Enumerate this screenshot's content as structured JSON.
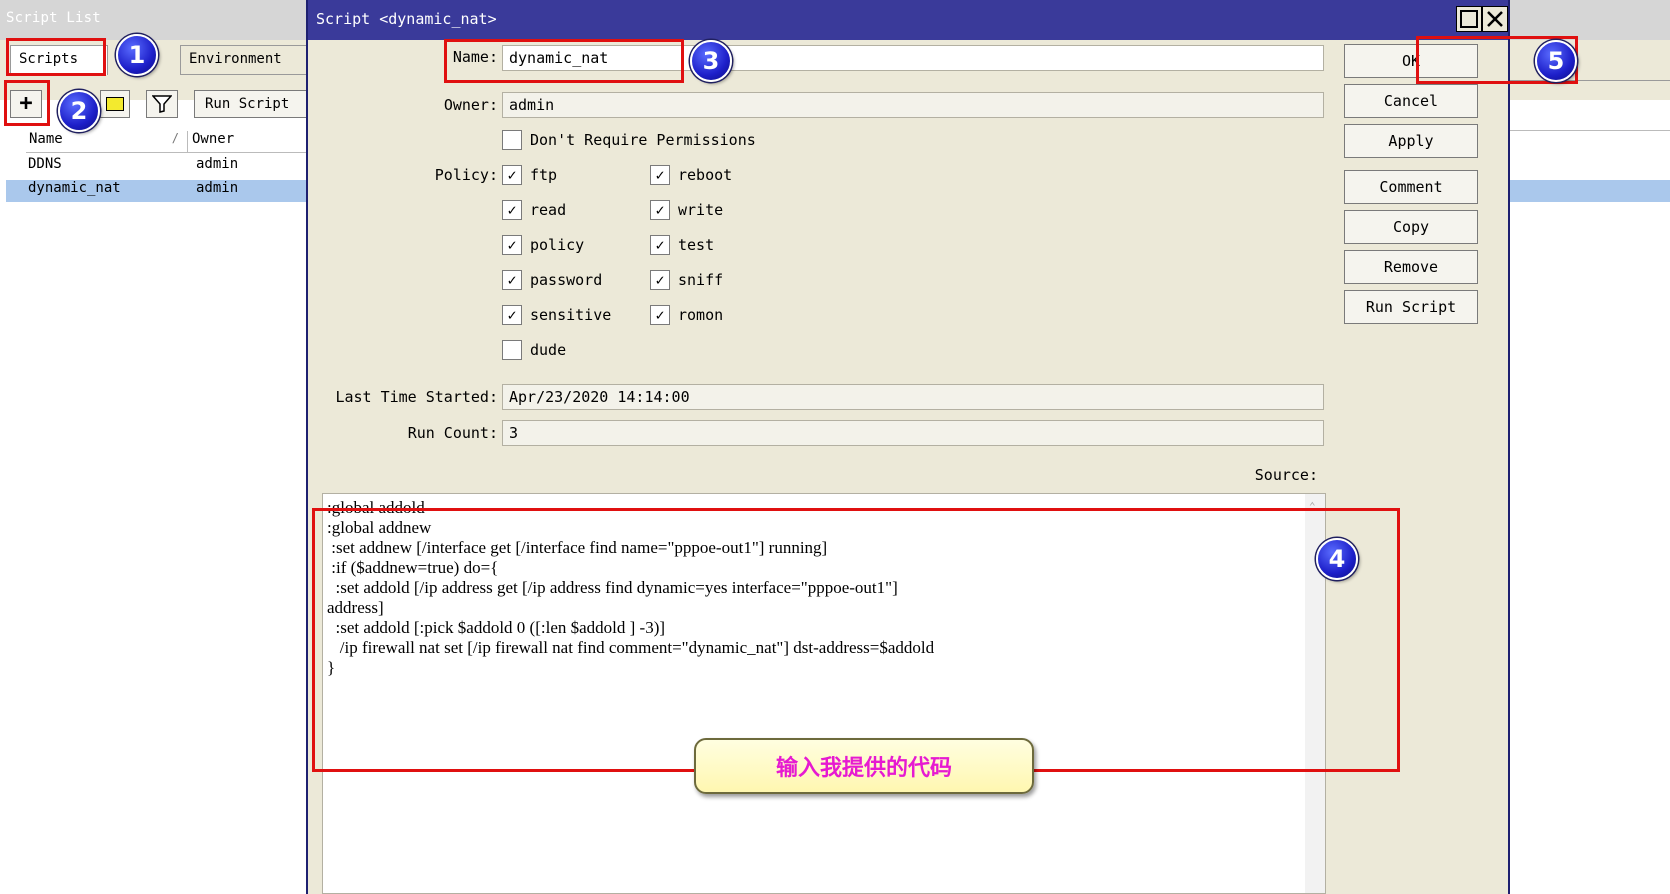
{
  "bg_window": {
    "title": "Script List",
    "tabs": [
      "Scripts",
      "Environment"
    ],
    "toolbar": {
      "add_label": "+",
      "run_label": "Run Script"
    },
    "columns": {
      "name": "Name",
      "owner": "Owner"
    },
    "rows": [
      {
        "name": "DDNS",
        "owner": "admin"
      },
      {
        "name": "dynamic_nat",
        "owner": "admin"
      }
    ]
  },
  "dialog": {
    "title": "Script <dynamic_nat>",
    "name_label": "Name:",
    "name_value": "dynamic_nat",
    "owner_label": "Owner:",
    "owner_value": "admin",
    "dont_require_label": "Don't Require Permissions",
    "policy_label": "Policy:",
    "policies": [
      {
        "label": "ftp",
        "checked": true
      },
      {
        "label": "reboot",
        "checked": true
      },
      {
        "label": "read",
        "checked": true
      },
      {
        "label": "write",
        "checked": true
      },
      {
        "label": "policy",
        "checked": true
      },
      {
        "label": "test",
        "checked": true
      },
      {
        "label": "password",
        "checked": true
      },
      {
        "label": "sniff",
        "checked": true
      },
      {
        "label": "sensitive",
        "checked": true
      },
      {
        "label": "romon",
        "checked": true
      },
      {
        "label": "dude",
        "checked": false
      }
    ],
    "last_started_label": "Last Time Started:",
    "last_started_value": "Apr/23/2020 14:14:00",
    "run_count_label": "Run Count:",
    "run_count_value": "3",
    "source_label": "Source:",
    "source_text": ":global addold\n:global addnew\n :set addnew [/interface get [/interface find name=\"pppoe-out1\"] running]\n :if ($addnew=true) do={\n  :set addold [/ip address get [/ip address find dynamic=yes interface=\"pppoe-out1\"]\naddress]\n  :set addold [:pick $addold 0 ([:len $addold ] -3)]\n   /ip firewall nat set [/ip firewall nat find comment=\"dynamic_nat\"] dst-address=$addold\n}",
    "buttons": {
      "ok": "OK",
      "cancel": "Cancel",
      "apply": "Apply",
      "comment": "Comment",
      "copy": "Copy",
      "remove": "Remove",
      "run_script": "Run Script"
    }
  },
  "annotations": {
    "badges": [
      "1",
      "2",
      "3",
      "4",
      "5"
    ],
    "callout_text": "输入我提供的代码"
  },
  "colors": {
    "highlight_red": "#e01010",
    "badge_blue": "#1d1fc9",
    "callout_text": "#e61ad1",
    "selection": "#aac8ec",
    "dialog_title": "#3a3a9a"
  }
}
